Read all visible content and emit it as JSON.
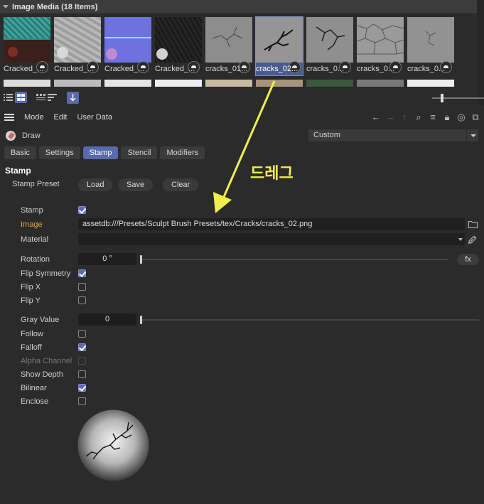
{
  "media": {
    "header": "Image Media (18 Items)",
    "items": [
      {
        "label": "Cracked_..."
      },
      {
        "label": "Cracked_..."
      },
      {
        "label": "Cracked_..."
      },
      {
        "label": "Cracked_..."
      },
      {
        "label": "cracks_01..."
      },
      {
        "label": "cracks_02..."
      },
      {
        "label": "cracks_0..."
      },
      {
        "label": "cracks_0..."
      },
      {
        "label": "cracks_0..."
      }
    ],
    "selected_index": 5
  },
  "menubar": {
    "items": [
      "Mode",
      "Edit",
      "User Data"
    ]
  },
  "object": {
    "label": "Draw",
    "preset_value": "Custom"
  },
  "tabs": [
    "Basic",
    "Settings",
    "Stamp",
    "Stencil",
    "Modifiers"
  ],
  "active_tab": "Stamp",
  "stamp": {
    "title": "Stamp",
    "preset_label": "Stamp Preset",
    "buttons": {
      "load": "Load",
      "save": "Save",
      "clear": "Clear"
    },
    "props": {
      "stamp_label": "Stamp",
      "stamp_checked": true,
      "image_label": "Image",
      "image_path": "assetdb:///Presets/Sculpt Brush Presets/tex/Cracks/cracks_02.png",
      "material_label": "Material",
      "rotation_label": "Rotation",
      "rotation_value": "0 °",
      "flip_symmetry_label": "Flip Symmetry",
      "flip_symmetry_checked": true,
      "flip_x_label": "Flip X",
      "flip_y_label": "Flip Y",
      "gray_label": "Gray Value",
      "gray_value": "0",
      "follow_label": "Follow",
      "falloff_label": "Falloff",
      "falloff_checked": true,
      "alpha_label": "Alpha Channel",
      "show_depth_label": "Show Depth",
      "bilinear_label": "Bilinear",
      "bilinear_checked": true,
      "enclose_label": "Enclose",
      "fx_label": "fx"
    }
  },
  "annotation": {
    "text": "드레그",
    "color": "#f2f04c"
  },
  "colors": {
    "accent": "#5869ad",
    "background": "#2b2b2b",
    "image_label": "#e8a33e"
  }
}
